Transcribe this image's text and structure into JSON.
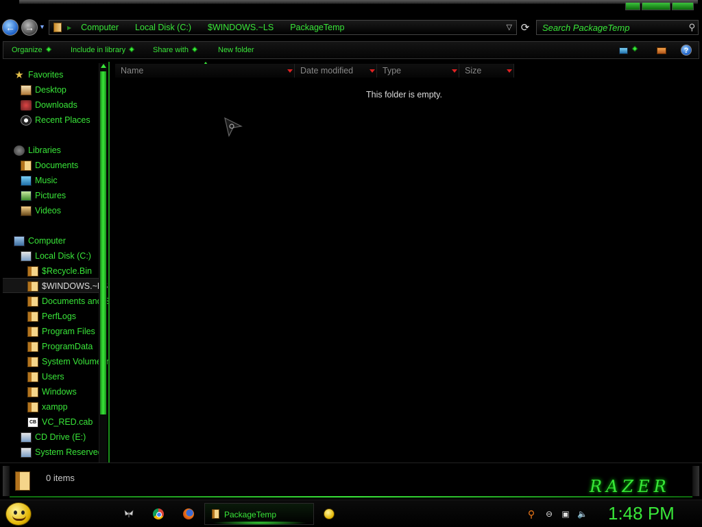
{
  "address_bar": {
    "crumbs": [
      "Computer",
      "Local Disk (C:)",
      "$WINDOWS.~LS",
      "PackageTemp"
    ]
  },
  "search": {
    "placeholder": "Search PackageTemp"
  },
  "commands": {
    "organize": "Organize",
    "include_in_library": "Include in library",
    "share_with": "Share with",
    "new_folder": "New folder"
  },
  "nav_pane": {
    "favorites": {
      "label": "Favorites",
      "items": [
        "Desktop",
        "Downloads",
        "Recent Places"
      ]
    },
    "libraries": {
      "label": "Libraries",
      "items": [
        "Documents",
        "Music",
        "Pictures",
        "Videos"
      ]
    },
    "computer": {
      "label": "Computer",
      "local_disk": "Local Disk (C:)",
      "folders": [
        "$Recycle.Bin",
        "$WINDOWS.~LS",
        "Documents and Settings",
        "PerfLogs",
        "Program Files",
        "ProgramData",
        "System Volume Information",
        "Users",
        "Windows",
        "xampp",
        "VC_RED.cab"
      ],
      "cd_drive": "CD Drive (E:)",
      "system_reserved": "System Reserved"
    }
  },
  "columns": {
    "name": "Name",
    "date_modified": "Date modified",
    "type": "Type",
    "size": "Size"
  },
  "content": {
    "empty_message": "This folder is empty."
  },
  "details": {
    "item_count": "0 items",
    "brand": "RAZER"
  },
  "taskbar": {
    "active_window": "PackageTemp",
    "clock": "1:48 PM"
  },
  "colors": {
    "accent": "#39e639",
    "background": "#000000",
    "sort_arrow": "#dd2222"
  },
  "icons": [
    "back-arrow-icon",
    "forward-arrow-icon",
    "refresh-icon",
    "search-icon",
    "help-icon",
    "folder-icon",
    "drive-icon",
    "star-icon",
    "start-orb-icon"
  ]
}
